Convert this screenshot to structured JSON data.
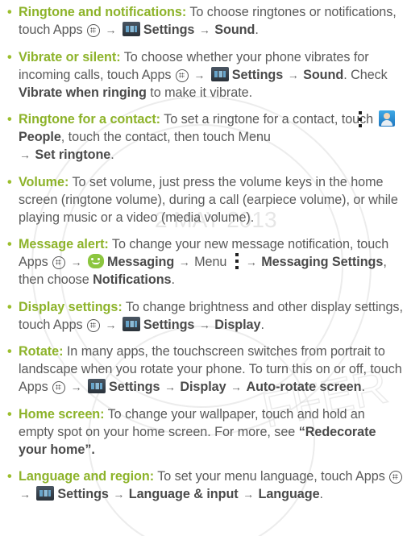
{
  "bullet": "•",
  "arrow": "→",
  "items": [
    {
      "title": "Ringtone and notifications:",
      "t1": " To choose ringtones or notifications, touch Apps ",
      "b1": "Settings",
      "b2": "Sound",
      "end": "."
    },
    {
      "title": "Vibrate or silent:",
      "t1": " To choose whether your phone vibrates for incoming calls, touch Apps ",
      "b1": "Settings",
      "b2": "Sound",
      "t2": ". Check ",
      "b3": "Vibrate when ringing",
      "t3": " to make it vibrate."
    },
    {
      "title": "Ringtone for a contact:",
      "t1": " To set a ringtone for a contact, touch ",
      "b1": "People",
      "t2": ", touch the contact, then touch Menu ",
      "b2": "Set ringtone",
      "end": "."
    },
    {
      "title": "Volume:",
      "t1": " To set volume, just press the volume keys in the home screen (ringtone volume), during a call (earpiece volume), or while playing music or a video (media volume)."
    },
    {
      "title": "Message alert:",
      "t1": " To change your new message notification, touch Apps ",
      "b1": "Messaging",
      "t2": " Menu ",
      "b2": "Messaging Settings",
      "t3": ", then choose ",
      "b3": "Notifications",
      "end": "."
    },
    {
      "title": "Display settings:",
      "t1": " To change brightness and other display settings, touch Apps ",
      "b1": "Settings",
      "b2": "Display",
      "end": "."
    },
    {
      "title": "Rotate:",
      "t1": " In many apps, the touchscreen switches from portrait to landscape when you rotate your phone. To turn this on or off, touch Apps ",
      "b1": "Settings",
      "b2": "Display",
      "b3": "Auto-rotate screen",
      "end": "."
    },
    {
      "title": "Home screen:",
      "t1": " To change your wallpaper, touch and hold an empty spot on your home screen. For more, see ",
      "q1": "“",
      "b1": "Redecorate your home",
      "q2": "”."
    },
    {
      "title": "Language and region:",
      "t1": " To set your menu language, touch Apps ",
      "b1": "Settings",
      "b2": "Language & input",
      "b3": "Language",
      "end": "."
    }
  ],
  "icons": {
    "apps": "apps-launcher-icon",
    "settings": "settings-app-icon",
    "people": "people-app-icon",
    "messaging": "messaging-app-icon",
    "menu": "menu-overflow-icon"
  },
  "watermark": {
    "date_stamp": "2 MAY 2013",
    "seal_fragment": "FFER"
  },
  "colors": {
    "title_green": "#8db32a",
    "body_text": "#5a5a5a"
  }
}
